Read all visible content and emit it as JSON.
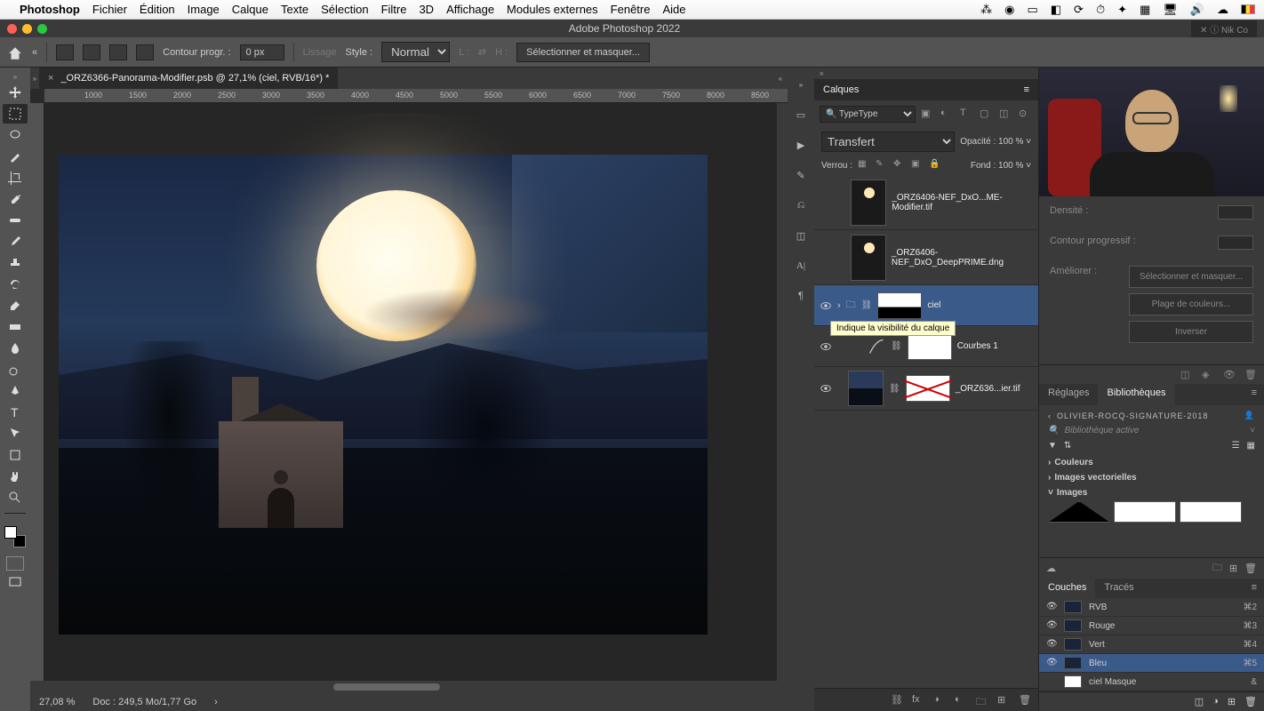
{
  "menubar": {
    "app": "Photoshop",
    "items": [
      "Fichier",
      "Édition",
      "Image",
      "Calque",
      "Texte",
      "Sélection",
      "Filtre",
      "3D",
      "Affichage",
      "Modules externes",
      "Fenêtre",
      "Aide"
    ]
  },
  "titlebar": {
    "title": "Adobe Photoshop 2022",
    "plugin_prefix_x": "✕",
    "plugin": "Nik Co"
  },
  "options": {
    "contour_label": "Contour progr. :",
    "contour_value": "0 px",
    "lissage": "Lissage",
    "style_label": "Style :",
    "style_value": "Normal",
    "L": "L :",
    "H": "H :",
    "select_mask": "Sélectionner et masquer..."
  },
  "document": {
    "tab": "_ORZ6366-Panorama-Modifier.psb @ 27,1% (ciel, RVB/16*) *",
    "ruler_ticks": [
      "1000",
      "1500",
      "2000",
      "2500",
      "3000",
      "3500",
      "4000",
      "4500",
      "5000",
      "5500",
      "6000",
      "6500",
      "7000",
      "7500",
      "8000",
      "8500"
    ],
    "ruler_v_ticks": [
      "0",
      "5",
      "0",
      "0",
      "1",
      "0",
      "0",
      "0",
      "1",
      "5",
      "0",
      "0",
      "2",
      "0",
      "0",
      "0"
    ],
    "zoom_status": "27,08 %",
    "doc_size": "Doc : 249,5 Mo/1,77 Go"
  },
  "layers_panel": {
    "tab": "Calques",
    "filter_kind": "Type",
    "blend_mode": "Transfert",
    "opacity_label": "Opacité :",
    "opacity_value": "100 %",
    "lock_label": "Verrou :",
    "fill_label": "Fond :",
    "fill_value": "100 %",
    "layers": [
      {
        "name": "_ORZ6406-NEF_DxO...ME-Modifier.tif"
      },
      {
        "name": "_ORZ6406-NEF_DxO_DeepPRIME.dng"
      },
      {
        "name": "ciel",
        "selected": true
      },
      {
        "name": "Courbes 1"
      },
      {
        "name": "_ORZ636...ier.tif"
      }
    ],
    "tooltip": "Indique la visibilité du calque"
  },
  "properties": {
    "density_label": "Densité :",
    "feather_label": "Contour progressif :",
    "enhance_label": "Améliorer :",
    "buttons": [
      "Sélectionner et masquer...",
      "Plage de couleurs...",
      "Inverser"
    ]
  },
  "libraries": {
    "tabs": [
      "Réglages",
      "Bibliothèques"
    ],
    "active_tab": 1,
    "crumb": "OLIVIER-ROCQ-SIGNATURE-2018",
    "search_placeholder": "Bibliothèque active",
    "sections": [
      {
        "title": "Couleurs",
        "open": false
      },
      {
        "title": "Images vectorielles",
        "open": false
      },
      {
        "title": "Images",
        "open": true
      }
    ]
  },
  "channels": {
    "tabs": [
      "Couches",
      "Tracés"
    ],
    "rows": [
      {
        "name": "RVB",
        "shortcut": "⌘2",
        "visible": true
      },
      {
        "name": "Rouge",
        "shortcut": "⌘3",
        "visible": true
      },
      {
        "name": "Vert",
        "shortcut": "⌘4",
        "visible": true
      },
      {
        "name": "Bleu",
        "shortcut": "⌘5",
        "visible": true,
        "selected": true
      },
      {
        "name": "ciel Masque",
        "shortcut": "&",
        "visible": false
      }
    ]
  }
}
